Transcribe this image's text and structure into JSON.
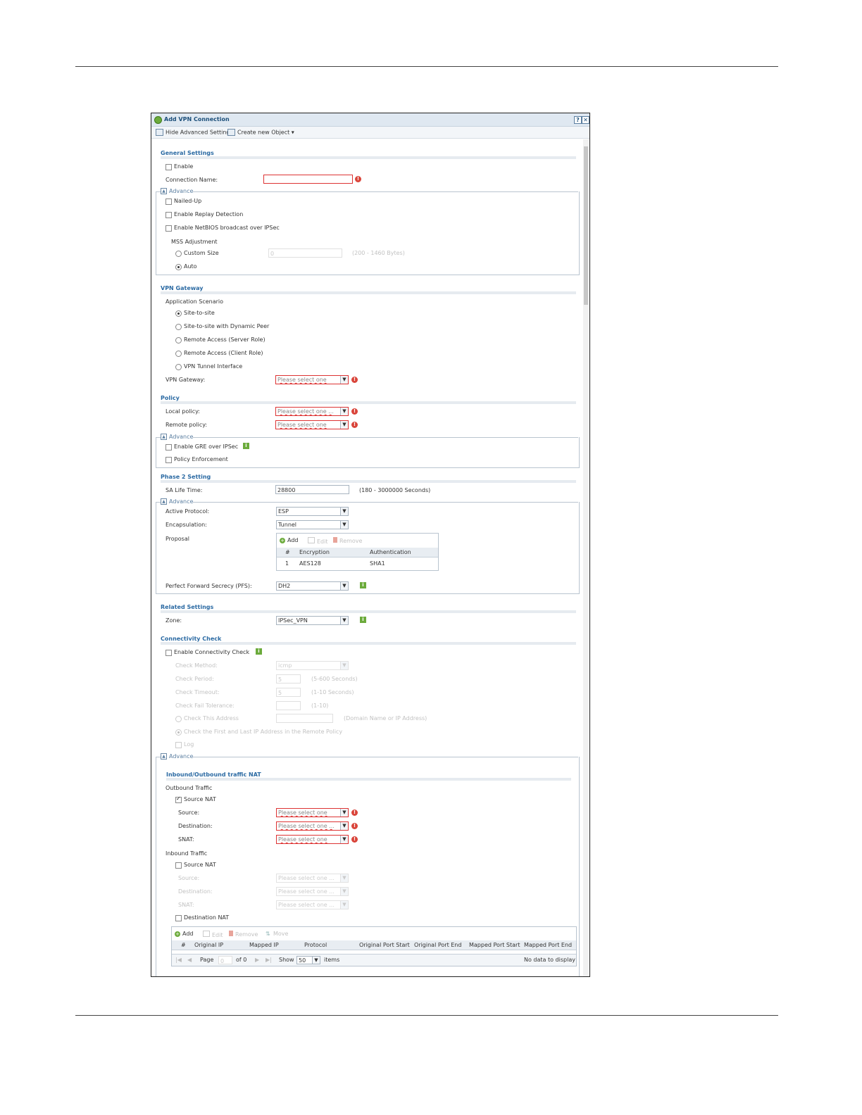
{
  "dialog": {
    "title": "Add VPN Connection",
    "help_label": "?",
    "close_label": "✕",
    "toolbar": {
      "hide_advanced": "Hide Advanced Settings",
      "create_object": "Create new Object ▾"
    }
  },
  "general": {
    "title": "General Settings",
    "enable": "Enable",
    "connection_name_label": "Connection Name:",
    "advance": "Advance",
    "nailed_up": "Nailed-Up",
    "replay_detection": "Enable Replay Detection",
    "netbios": "Enable NetBIOS broadcast over IPSec",
    "mss_title": "MSS Adjustment",
    "custom_size": "Custom Size",
    "custom_size_value": "0",
    "custom_size_hint": "(200 - 1460 Bytes)",
    "auto": "Auto"
  },
  "gateway": {
    "title": "VPN Gateway",
    "scenario_label": "Application Scenario",
    "scenarios": [
      "Site-to-site",
      "Site-to-site with Dynamic Peer",
      "Remote Access (Server Role)",
      "Remote Access (Client Role)",
      "VPN Tunnel Interface"
    ],
    "gateway_label": "VPN Gateway:",
    "gateway_value": "Please select one"
  },
  "policy": {
    "title": "Policy",
    "local_label": "Local policy:",
    "local_value": "Please select one ...",
    "remote_label": "Remote policy:",
    "remote_value": "Please select one",
    "advance": "Advance",
    "gre": "Enable GRE over IPSec",
    "enforcement": "Policy Enforcement"
  },
  "phase2": {
    "title": "Phase 2 Setting",
    "sa_label": "SA Life Time:",
    "sa_value": "28800",
    "sa_hint": "(180 - 3000000 Seconds)",
    "advance": "Advance",
    "protocol_label": "Active Protocol:",
    "protocol_value": "ESP",
    "encap_label": "Encapsulation:",
    "encap_value": "Tunnel",
    "proposal_label": "Proposal",
    "add": "Add",
    "edit": "Edit",
    "remove": "Remove",
    "columns": [
      "#",
      "Encryption",
      "Authentication"
    ],
    "row": [
      "1",
      "AES128",
      "SHA1"
    ],
    "pfs_label": "Perfect Forward Secrecy (PFS):",
    "pfs_value": "DH2"
  },
  "related": {
    "title": "Related Settings",
    "zone_label": "Zone:",
    "zone_value": "IPSec_VPN"
  },
  "connectivity": {
    "title": "Connectivity Check",
    "enable": "Enable Connectivity Check",
    "method_label": "Check Method:",
    "method_value": "icmp",
    "period_label": "Check Period:",
    "period_value": "5",
    "period_hint": "(5-600 Seconds)",
    "timeout_label": "Check Timeout:",
    "timeout_value": "5",
    "timeout_hint": "(1-10 Seconds)",
    "fail_label": "Check Fail Tolerance:",
    "fail_hint": "(1-10)",
    "address_label": "Check This Address",
    "address_hint": "(Domain Name or IP Address)",
    "first_last": "Check the First and Last IP Address in the Remote Policy",
    "log": "Log",
    "advance": "Advance"
  },
  "nat": {
    "title": "Inbound/Outbound traffic NAT",
    "outbound": "Outbound Traffic",
    "source_nat": "Source NAT",
    "source_label": "Source:",
    "dest_label": "Destination:",
    "snat_label": "SNAT:",
    "select_value": "Please select one",
    "select_value2": "Please select one ...",
    "inbound": "Inbound Traffic",
    "in_source_label": "Source:",
    "in_dest_label": "Destination:",
    "in_snat_label": "SNAT:",
    "dest_nat": "Destination NAT",
    "add": "Add",
    "edit": "Edit",
    "remove": "Remove",
    "move": "Move",
    "columns": [
      "#",
      "Original IP",
      "Mapped IP",
      "Protocol",
      "Original Port Start",
      "Original Port End",
      "Mapped Port Start",
      "Mapped Port End"
    ],
    "page_label": "Page",
    "page_value": "0",
    "of_label": "of 0",
    "show_label": "Show",
    "show_value": "50",
    "items_label": "items",
    "empty": "No data to display"
  }
}
